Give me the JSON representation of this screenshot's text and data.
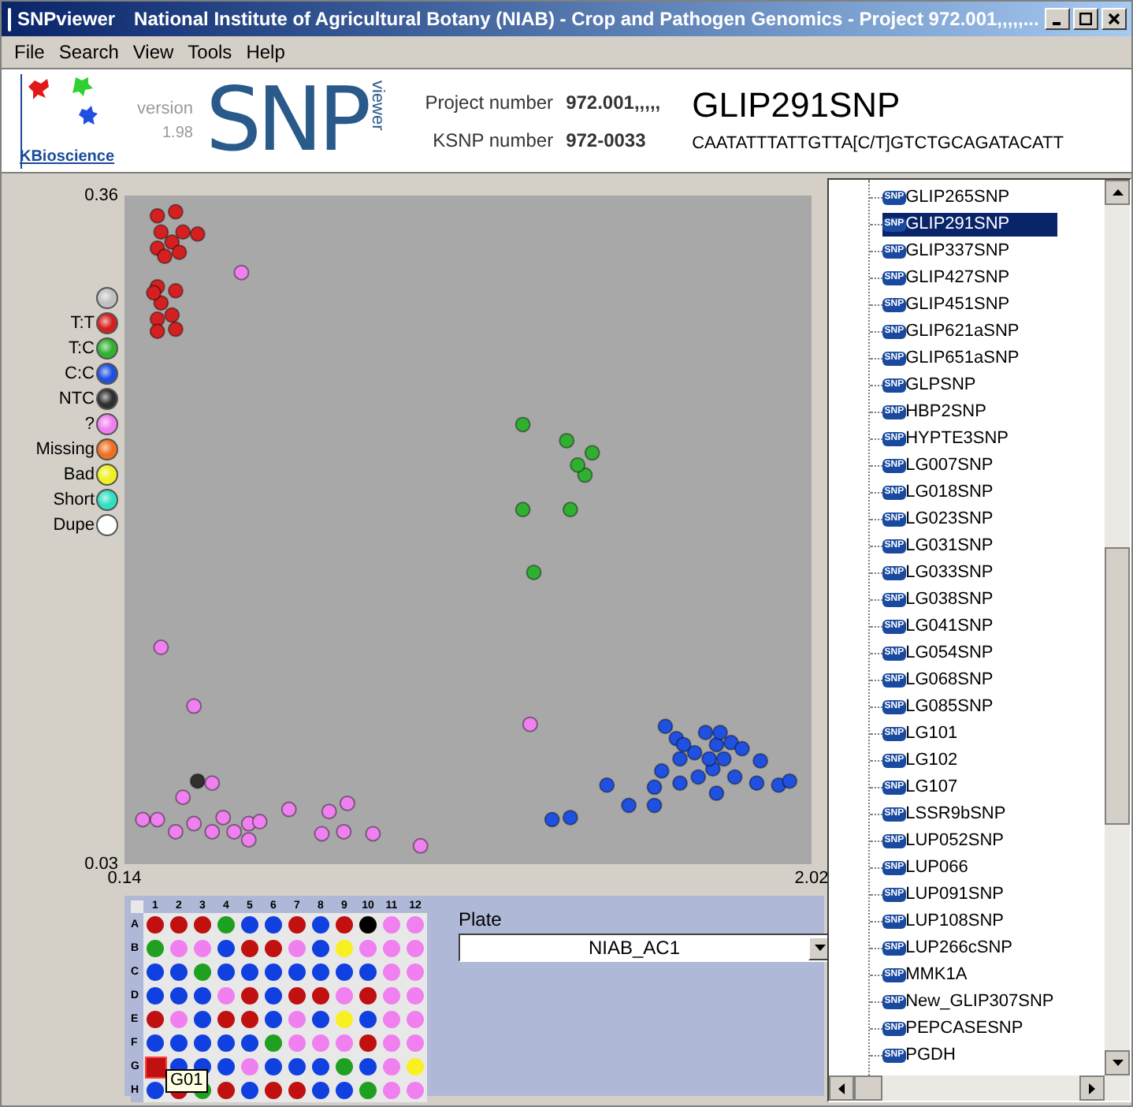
{
  "window": {
    "title": "SNPviewer",
    "caption": "National Institute of Agricultural Botany (NIAB) - Crop and Pathogen Genomics - Project 972.001,,,,,..."
  },
  "menu": [
    "File",
    "Search",
    "View",
    "Tools",
    "Help"
  ],
  "header": {
    "company": "KBioscience",
    "version_label": "version",
    "version": "1.98",
    "logo_main": "SNP",
    "logo_sub": "viewer",
    "project_label": "Project number",
    "project_value": "972.001,,,,,",
    "ksnp_label": "KSNP number",
    "ksnp_value": "972-0033",
    "marker": "GLIP291SNP",
    "sequence": "CAATATTTATTGTTA[C/T]GTCTGCAGATACATT"
  },
  "legend": {
    "before_series": [
      {
        "color": "#c0c0c0"
      }
    ],
    "after_series": [
      {
        "label": "Missing",
        "color": "#f07020"
      },
      {
        "label": "Bad",
        "color": "#f0f020"
      },
      {
        "label": "Short",
        "color": "#30e0c0"
      },
      {
        "label": "Dupe",
        "color": "#ffffff"
      }
    ]
  },
  "chart_data": {
    "type": "scatter",
    "legend": "left",
    "xlim": [
      0.14,
      2.02
    ],
    "ylim": [
      0.03,
      0.36
    ],
    "xticks": [
      {
        "value": 0.14,
        "label": "0.14"
      },
      {
        "value": 2.02,
        "label": "2.02"
      }
    ],
    "yticks": [
      {
        "value": 0.36,
        "label": "0.36"
      },
      {
        "value": 0.03,
        "label": "0.03"
      }
    ],
    "series": [
      {
        "name": "T:T",
        "color": "#d42020",
        "x": [
          0.23,
          0.28,
          0.24,
          0.3,
          0.34,
          0.23,
          0.27,
          0.25,
          0.29,
          0.23,
          0.28,
          0.24,
          0.23,
          0.27,
          0.23,
          0.28,
          0.22
        ],
        "values": [
          0.35,
          0.352,
          0.342,
          0.342,
          0.341,
          0.334,
          0.337,
          0.33,
          0.332,
          0.315,
          0.313,
          0.307,
          0.299,
          0.301,
          0.293,
          0.294,
          0.312
        ]
      },
      {
        "name": "T:C",
        "color": "#30b030",
        "x": [
          1.23,
          1.35,
          1.42,
          1.4,
          1.38,
          1.23,
          1.36,
          1.26
        ],
        "values": [
          0.247,
          0.239,
          0.233,
          0.222,
          0.227,
          0.205,
          0.205,
          0.174
        ]
      },
      {
        "name": "C:C",
        "color": "#2050e0",
        "x": [
          1.62,
          1.65,
          1.73,
          1.76,
          1.8,
          1.83,
          1.78,
          1.75,
          1.71,
          1.81,
          1.88,
          1.93,
          1.96,
          1.87,
          1.66,
          1.61,
          1.59,
          1.66,
          1.46,
          1.52,
          1.59,
          1.31,
          1.36,
          1.76,
          1.7,
          1.74,
          1.77,
          1.67
        ],
        "values": [
          0.098,
          0.092,
          0.095,
          0.089,
          0.09,
          0.087,
          0.082,
          0.077,
          0.073,
          0.073,
          0.081,
          0.069,
          0.071,
          0.07,
          0.082,
          0.076,
          0.068,
          0.07,
          0.069,
          0.059,
          0.059,
          0.052,
          0.053,
          0.065,
          0.085,
          0.082,
          0.095,
          0.089
        ]
      },
      {
        "name": "NTC",
        "color": "#303030",
        "x": [
          0.34
        ],
        "values": [
          0.071
        ]
      },
      {
        "name": "?",
        "color": "#f080f0",
        "x": [
          0.46,
          0.24,
          0.33,
          1.25,
          0.38,
          0.3,
          0.19,
          0.23,
          0.28,
          0.33,
          0.38,
          0.41,
          0.44,
          0.48,
          0.51,
          0.59,
          0.68,
          0.7,
          0.75,
          0.74,
          0.82,
          0.95,
          0.48
        ],
        "values": [
          0.322,
          0.137,
          0.108,
          0.099,
          0.07,
          0.063,
          0.052,
          0.052,
          0.046,
          0.05,
          0.046,
          0.053,
          0.046,
          0.05,
          0.051,
          0.057,
          0.045,
          0.056,
          0.06,
          0.046,
          0.045,
          0.039,
          0.042
        ]
      }
    ]
  },
  "plate": {
    "columns": [
      "1",
      "2",
      "3",
      "4",
      "5",
      "6",
      "7",
      "8",
      "9",
      "10",
      "11",
      "12"
    ],
    "rows": [
      {
        "label": "A",
        "wells": [
          {
            "color": "#c01010",
            "selected": false
          },
          {
            "color": "#c01010",
            "selected": false
          },
          {
            "color": "#c01010",
            "selected": false
          },
          {
            "color": "#20a020",
            "selected": false
          },
          {
            "color": "#1040e0",
            "selected": false
          },
          {
            "color": "#1040e0",
            "selected": false
          },
          {
            "color": "#c01010",
            "selected": false
          },
          {
            "color": "#1040e0",
            "selected": false
          },
          {
            "color": "#c01010",
            "selected": false
          },
          {
            "color": "#000000",
            "selected": false
          },
          {
            "color": "#f080f0",
            "selected": false
          },
          {
            "color": "#f080f0",
            "selected": false
          }
        ]
      },
      {
        "label": "B",
        "wells": [
          {
            "color": "#20a020",
            "selected": false
          },
          {
            "color": "#f080f0",
            "selected": false
          },
          {
            "color": "#f080f0",
            "selected": false
          },
          {
            "color": "#1040e0",
            "selected": false
          },
          {
            "color": "#c01010",
            "selected": false
          },
          {
            "color": "#c01010",
            "selected": false
          },
          {
            "color": "#f080f0",
            "selected": false
          },
          {
            "color": "#1040e0",
            "selected": false
          },
          {
            "color": "#f8f020",
            "selected": false
          },
          {
            "color": "#f080f0",
            "selected": false
          },
          {
            "color": "#f080f0",
            "selected": false
          },
          {
            "color": "#f080f0",
            "selected": false
          }
        ]
      },
      {
        "label": "C",
        "wells": [
          {
            "color": "#1040e0",
            "selected": false
          },
          {
            "color": "#1040e0",
            "selected": false
          },
          {
            "color": "#20a020",
            "selected": false
          },
          {
            "color": "#1040e0",
            "selected": false
          },
          {
            "color": "#1040e0",
            "selected": false
          },
          {
            "color": "#1040e0",
            "selected": false
          },
          {
            "color": "#1040e0",
            "selected": false
          },
          {
            "color": "#1040e0",
            "selected": false
          },
          {
            "color": "#1040e0",
            "selected": false
          },
          {
            "color": "#1040e0",
            "selected": false
          },
          {
            "color": "#f080f0",
            "selected": false
          },
          {
            "color": "#f080f0",
            "selected": false
          }
        ]
      },
      {
        "label": "D",
        "wells": [
          {
            "color": "#1040e0",
            "selected": false
          },
          {
            "color": "#1040e0",
            "selected": false
          },
          {
            "color": "#1040e0",
            "selected": false
          },
          {
            "color": "#f080f0",
            "selected": false
          },
          {
            "color": "#c01010",
            "selected": false
          },
          {
            "color": "#1040e0",
            "selected": false
          },
          {
            "color": "#c01010",
            "selected": false
          },
          {
            "color": "#c01010",
            "selected": false
          },
          {
            "color": "#f080f0",
            "selected": false
          },
          {
            "color": "#c01010",
            "selected": false
          },
          {
            "color": "#f080f0",
            "selected": false
          },
          {
            "color": "#f080f0",
            "selected": false
          }
        ]
      },
      {
        "label": "E",
        "wells": [
          {
            "color": "#c01010",
            "selected": false
          },
          {
            "color": "#f080f0",
            "selected": false
          },
          {
            "color": "#1040e0",
            "selected": false
          },
          {
            "color": "#c01010",
            "selected": false
          },
          {
            "color": "#c01010",
            "selected": false
          },
          {
            "color": "#1040e0",
            "selected": false
          },
          {
            "color": "#f080f0",
            "selected": false
          },
          {
            "color": "#1040e0",
            "selected": false
          },
          {
            "color": "#f8f020",
            "selected": false
          },
          {
            "color": "#1040e0",
            "selected": false
          },
          {
            "color": "#f080f0",
            "selected": false
          },
          {
            "color": "#f080f0",
            "selected": false
          }
        ]
      },
      {
        "label": "F",
        "wells": [
          {
            "color": "#1040e0",
            "selected": false
          },
          {
            "color": "#1040e0",
            "selected": false
          },
          {
            "color": "#1040e0",
            "selected": false
          },
          {
            "color": "#1040e0",
            "selected": false
          },
          {
            "color": "#1040e0",
            "selected": false
          },
          {
            "color": "#20a020",
            "selected": false
          },
          {
            "color": "#f080f0",
            "selected": false
          },
          {
            "color": "#f080f0",
            "selected": false
          },
          {
            "color": "#f080f0",
            "selected": false
          },
          {
            "color": "#c01010",
            "selected": false
          },
          {
            "color": "#f080f0",
            "selected": false
          },
          {
            "color": "#f080f0",
            "selected": false
          }
        ]
      },
      {
        "label": "G",
        "wells": [
          {
            "color": "#c01010",
            "selected": true,
            "tooltip": "G01"
          },
          {
            "color": "#1040e0",
            "selected": false
          },
          {
            "color": "#1040e0",
            "selected": false
          },
          {
            "color": "#1040e0",
            "selected": false
          },
          {
            "color": "#f080f0",
            "selected": false
          },
          {
            "color": "#1040e0",
            "selected": false
          },
          {
            "color": "#1040e0",
            "selected": false
          },
          {
            "color": "#1040e0",
            "selected": false
          },
          {
            "color": "#20a020",
            "selected": false
          },
          {
            "color": "#1040e0",
            "selected": false
          },
          {
            "color": "#f080f0",
            "selected": false
          },
          {
            "color": "#f8f020",
            "selected": false
          }
        ]
      },
      {
        "label": "H",
        "wells": [
          {
            "color": "#1040e0",
            "selected": false
          },
          {
            "color": "#c01010",
            "selected": false
          },
          {
            "color": "#20a020",
            "selected": false
          },
          {
            "color": "#c01010",
            "selected": false
          },
          {
            "color": "#1040e0",
            "selected": false
          },
          {
            "color": "#c01010",
            "selected": false
          },
          {
            "color": "#c01010",
            "selected": false
          },
          {
            "color": "#1040e0",
            "selected": false
          },
          {
            "color": "#1040e0",
            "selected": false
          },
          {
            "color": "#20a020",
            "selected": false
          },
          {
            "color": "#f080f0",
            "selected": false
          },
          {
            "color": "#f080f0",
            "selected": false
          }
        ]
      }
    ],
    "plate_label": "Plate",
    "plate_value": "NIAB_AC1"
  },
  "tree": {
    "items": [
      {
        "badge": "SNP",
        "label": "GLIP265SNP",
        "selected": false
      },
      {
        "badge": "SNP",
        "label": "GLIP291SNP",
        "selected": true
      },
      {
        "badge": "SNP",
        "label": "GLIP337SNP",
        "selected": false
      },
      {
        "badge": "SNP",
        "label": "GLIP427SNP",
        "selected": false
      },
      {
        "badge": "SNP",
        "label": "GLIP451SNP",
        "selected": false
      },
      {
        "badge": "SNP",
        "label": "GLIP621aSNP",
        "selected": false
      },
      {
        "badge": "SNP",
        "label": "GLIP651aSNP",
        "selected": false
      },
      {
        "badge": "SNP",
        "label": "GLPSNP",
        "selected": false
      },
      {
        "badge": "SNP",
        "label": "HBP2SNP",
        "selected": false
      },
      {
        "badge": "SNP",
        "label": "HYPTE3SNP",
        "selected": false
      },
      {
        "badge": "SNP",
        "label": "LG007SNP",
        "selected": false
      },
      {
        "badge": "SNP",
        "label": "LG018SNP",
        "selected": false
      },
      {
        "badge": "SNP",
        "label": "LG023SNP",
        "selected": false
      },
      {
        "badge": "SNP",
        "label": "LG031SNP",
        "selected": false
      },
      {
        "badge": "SNP",
        "label": "LG033SNP",
        "selected": false
      },
      {
        "badge": "SNP",
        "label": "LG038SNP",
        "selected": false
      },
      {
        "badge": "SNP",
        "label": "LG041SNP",
        "selected": false
      },
      {
        "badge": "SNP",
        "label": "LG054SNP",
        "selected": false
      },
      {
        "badge": "SNP",
        "label": "LG068SNP",
        "selected": false
      },
      {
        "badge": "SNP",
        "label": "LG085SNP",
        "selected": false
      },
      {
        "badge": "SNP",
        "label": "LG101",
        "selected": false
      },
      {
        "badge": "SNP",
        "label": "LG102",
        "selected": false
      },
      {
        "badge": "SNP",
        "label": "LG107",
        "selected": false
      },
      {
        "badge": "SNP",
        "label": "LSSR9bSNP",
        "selected": false
      },
      {
        "badge": "SNP",
        "label": "LUP052SNP",
        "selected": false
      },
      {
        "badge": "SNP",
        "label": "LUP066",
        "selected": false
      },
      {
        "badge": "SNP",
        "label": "LUP091SNP",
        "selected": false
      },
      {
        "badge": "SNP",
        "label": "LUP108SNP",
        "selected": false
      },
      {
        "badge": "SNP",
        "label": "LUP266cSNP",
        "selected": false
      },
      {
        "badge": "SNP",
        "label": "MMK1A",
        "selected": false
      },
      {
        "badge": "SNP",
        "label": "New_GLIP307SNP",
        "selected": false
      },
      {
        "badge": "SNP",
        "label": "PEPCASESNP",
        "selected": false
      },
      {
        "badge": "SNP",
        "label": "PGDH",
        "selected": false
      }
    ]
  }
}
